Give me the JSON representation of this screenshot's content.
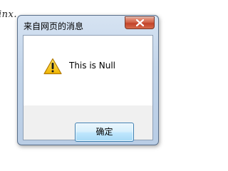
{
  "background": {
    "partial_text": "inx."
  },
  "dialog": {
    "title": "来自网页的消息",
    "message": "This is Null",
    "icon": "warning-icon",
    "ok_label": "确定",
    "close_icon": "close-icon"
  },
  "colors": {
    "close_button": "#c2432a",
    "ok_button_border": "#3c7fb1",
    "warning_yellow": "#f5c400"
  }
}
